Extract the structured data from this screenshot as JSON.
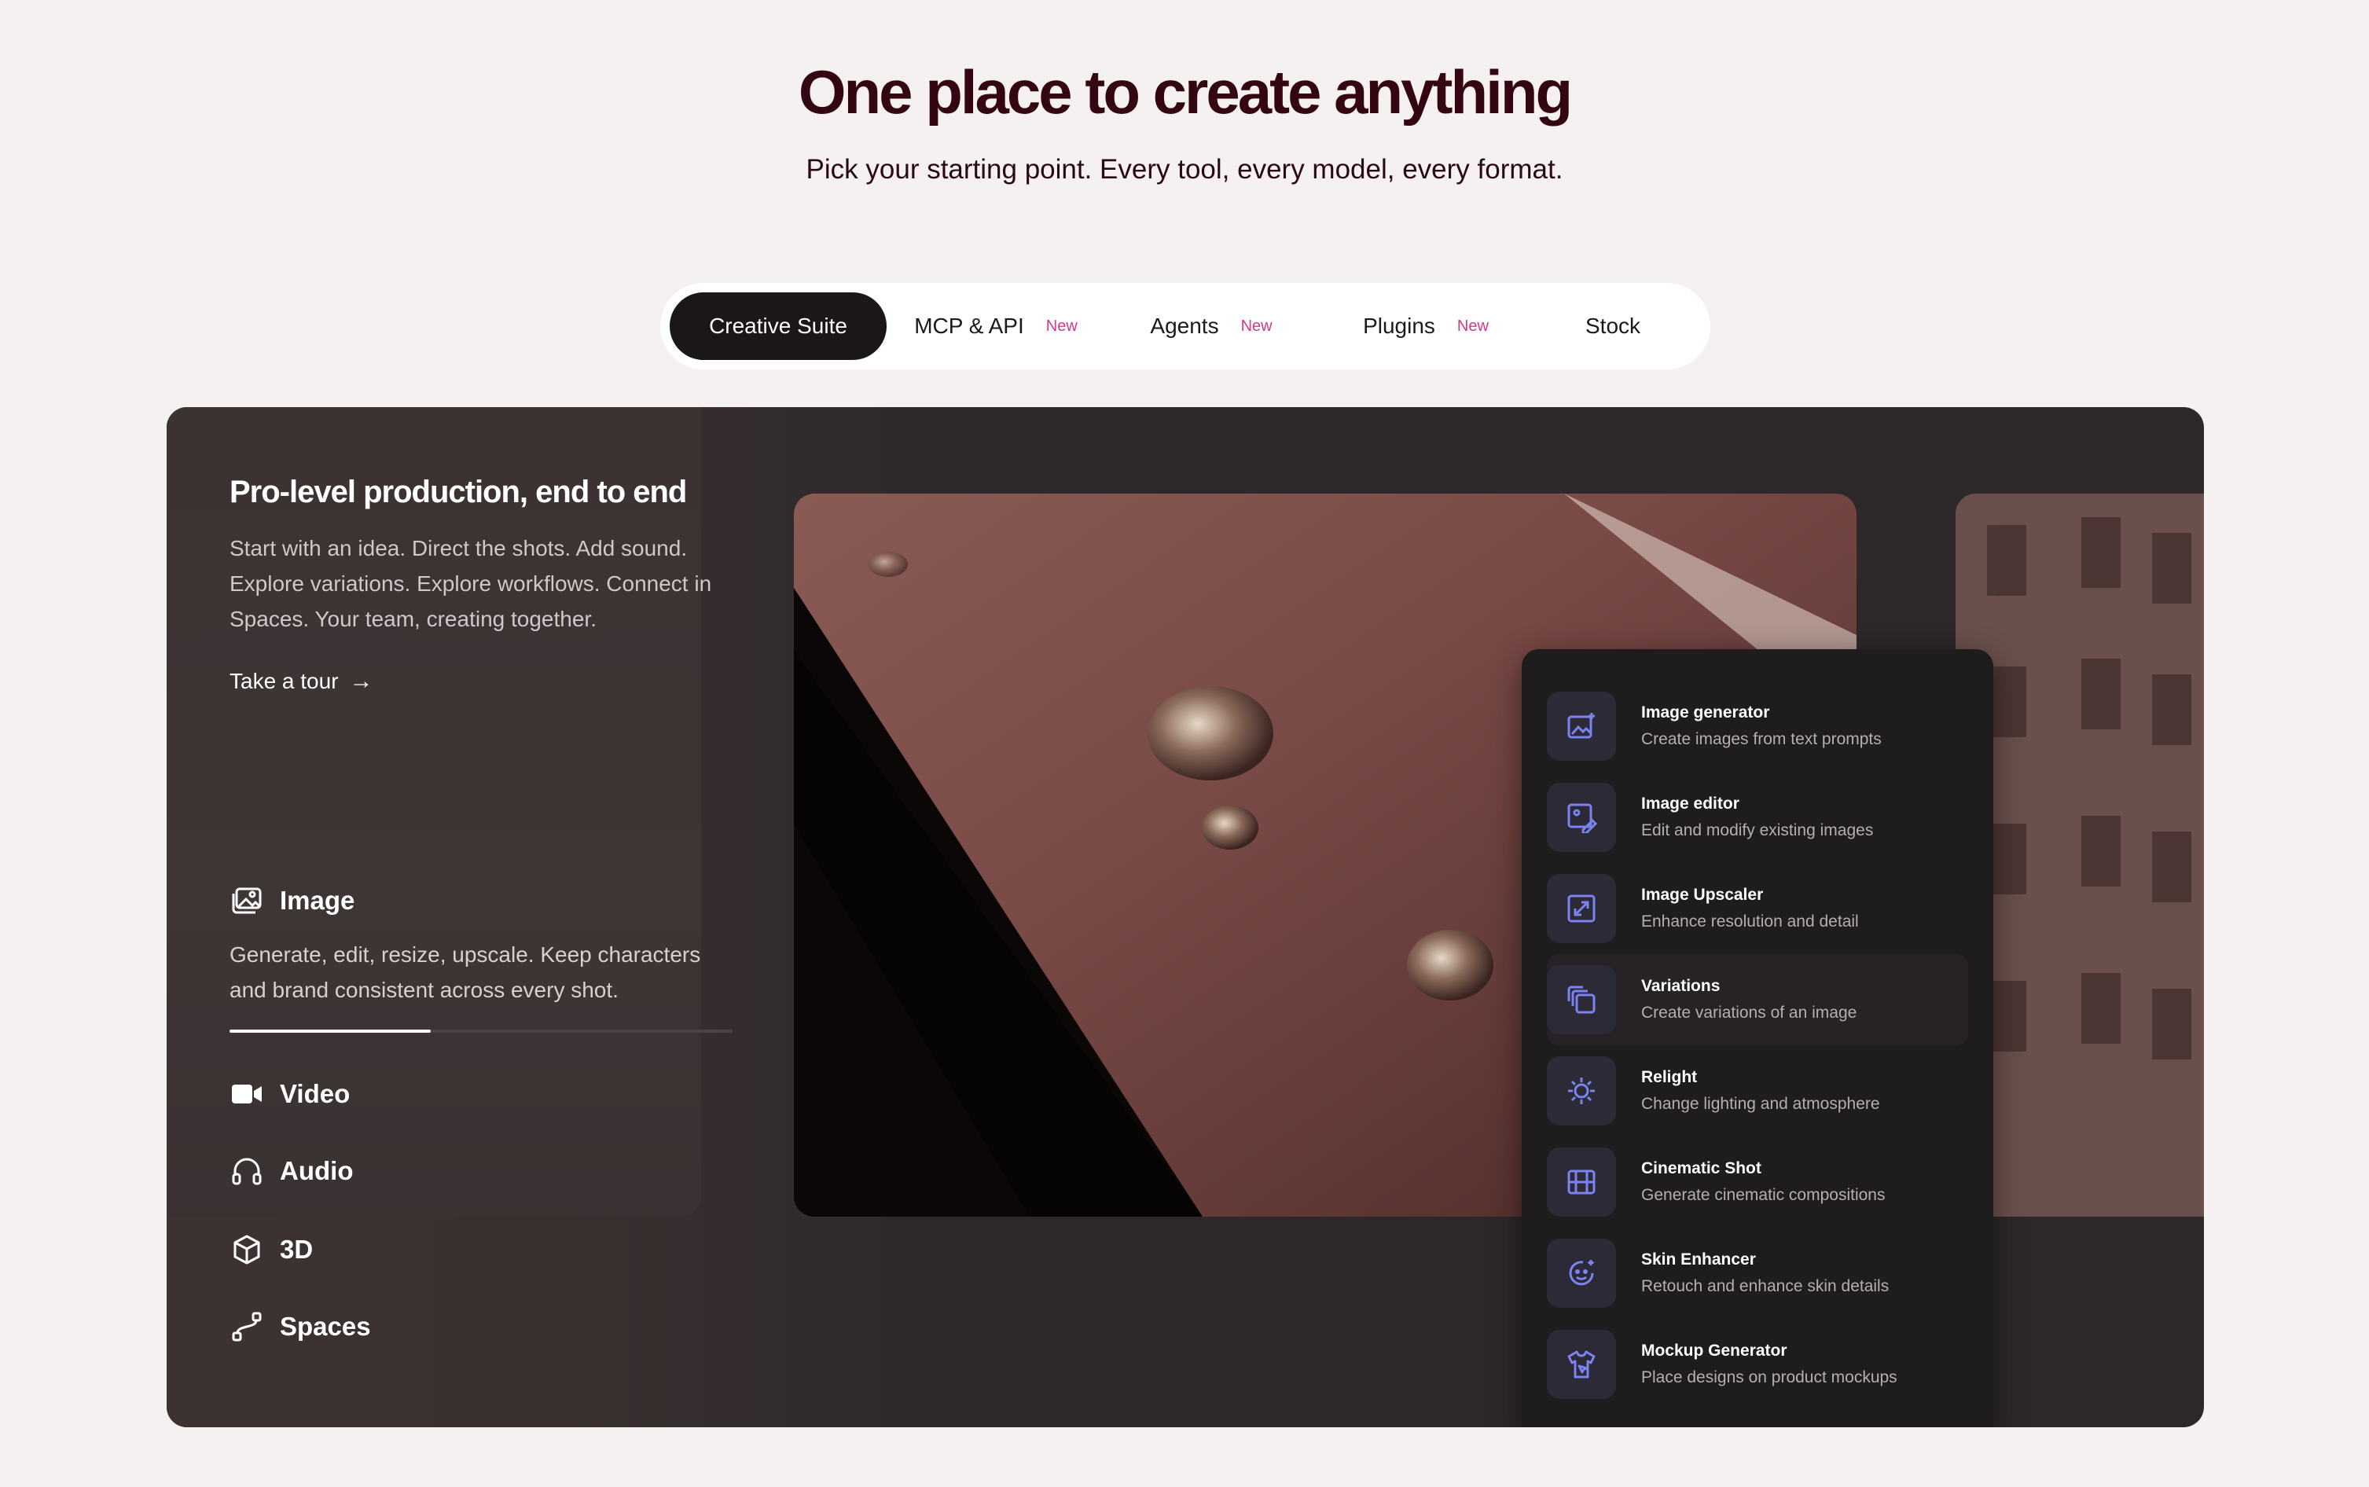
{
  "hero": {
    "title": "One place to create anything",
    "subtitle": "Pick your starting point. Every tool, every model, every format."
  },
  "tabs": [
    {
      "label": "Creative Suite",
      "badge": ""
    },
    {
      "label": "MCP & API",
      "badge": "New"
    },
    {
      "label": "Agents",
      "badge": "New"
    },
    {
      "label": "Plugins",
      "badge": "New"
    },
    {
      "label": "Stock",
      "badge": ""
    }
  ],
  "panel": {
    "title": "Pro-level production, end to end",
    "description": "Start with an idea. Direct the shots. Add sound. Explore variations. Explore workflows. Connect in Spaces. Your team, creating together.",
    "tour_label": "Take a tour",
    "tour_arrow": "→"
  },
  "categories": {
    "image": {
      "label": "Image",
      "description": "Generate, edit, resize, upscale. Keep characters and brand consistent across every shot.",
      "progress": 0.4
    },
    "video": {
      "label": "Video"
    },
    "audio": {
      "label": "Audio"
    },
    "three_d": {
      "label": "3D"
    },
    "spaces": {
      "label": "Spaces"
    }
  },
  "menu": [
    {
      "title": "Image generator",
      "desc": "Create images from text prompts",
      "icon": "image-sparkle-icon"
    },
    {
      "title": "Image editor",
      "desc": "Edit and modify existing images",
      "icon": "image-edit-icon"
    },
    {
      "title": "Image Upscaler",
      "desc": "Enhance resolution and detail",
      "icon": "expand-icon"
    },
    {
      "title": "Variations",
      "desc": "Create variations of an image",
      "icon": "layers-icon"
    },
    {
      "title": "Relight",
      "desc": "Change lighting and atmosphere",
      "icon": "sun-icon"
    },
    {
      "title": "Cinematic Shot",
      "desc": "Generate cinematic compositions",
      "icon": "film-icon"
    },
    {
      "title": "Skin Enhancer",
      "desc": "Retouch and enhance skin details",
      "icon": "face-sparkle-icon"
    },
    {
      "title": "Mockup Generator",
      "desc": "Place designs on product mockups",
      "icon": "shirt-icon"
    }
  ],
  "colors": {
    "accent_icon": "#7b83ee",
    "badge": "#d03a8c",
    "title": "#330611"
  }
}
